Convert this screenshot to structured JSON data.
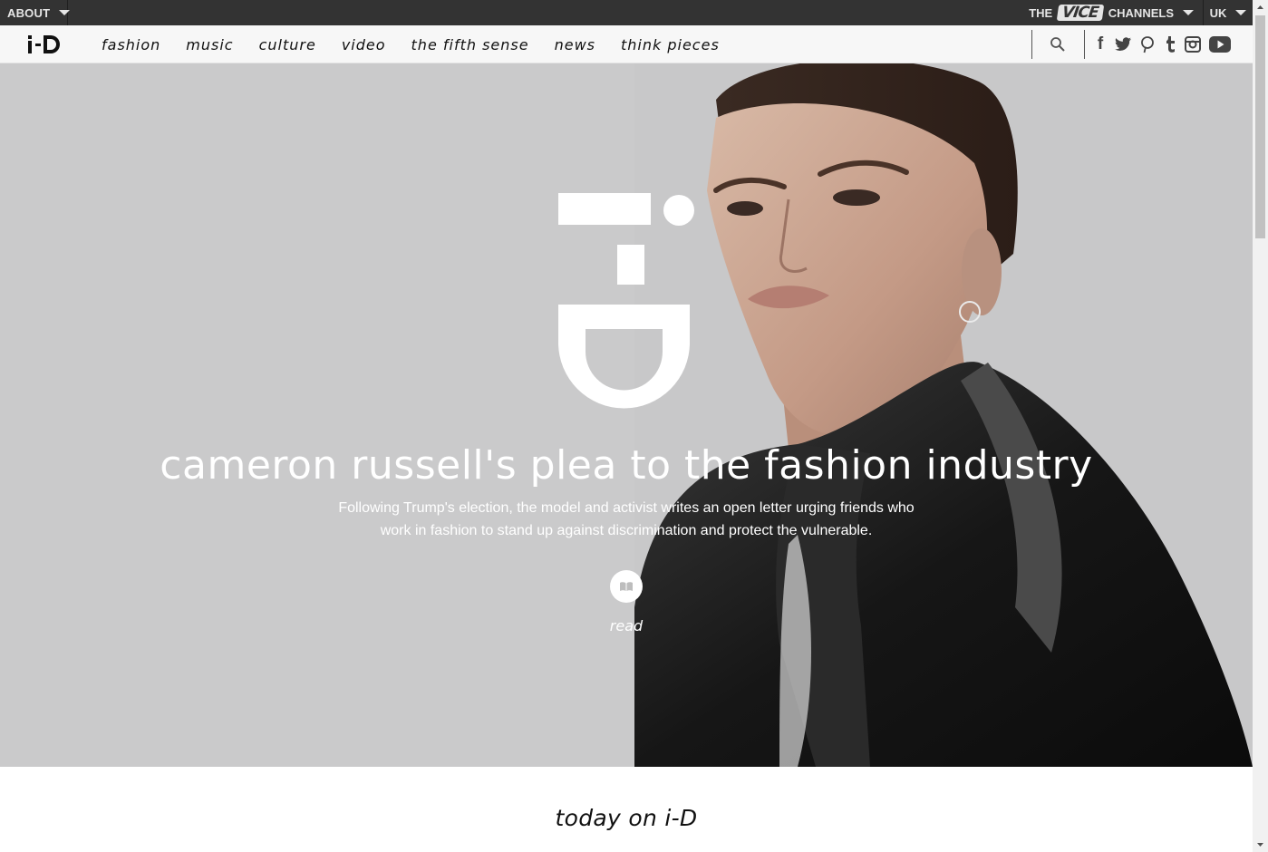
{
  "topbar": {
    "about_label": "ABOUT",
    "channels_prefix": "THE",
    "channels_brand": "VICE",
    "channels_label": "CHANNELS",
    "region_label": "UK"
  },
  "navbar": {
    "logo_alt": "i-D",
    "links": [
      "fashion",
      "music",
      "culture",
      "video",
      "the fifth sense",
      "news",
      "think pieces"
    ],
    "social": [
      "facebook-icon",
      "twitter-icon",
      "pinterest-icon",
      "tumblr-icon",
      "instagram-icon",
      "youtube-icon"
    ]
  },
  "hero": {
    "title": "cameron russell's plea to the fashion industry",
    "description": "Following Trump's election, the model and activist writes an open letter urging friends who work in fashion to stand up against discrimination and protect the vulnerable.",
    "read_label": "read"
  },
  "section": {
    "heading": "today on i-D"
  },
  "colors": {
    "topbar_bg": "#333333",
    "navbar_bg": "#f7f7f7",
    "hero_bg": "#c9c9ca"
  }
}
